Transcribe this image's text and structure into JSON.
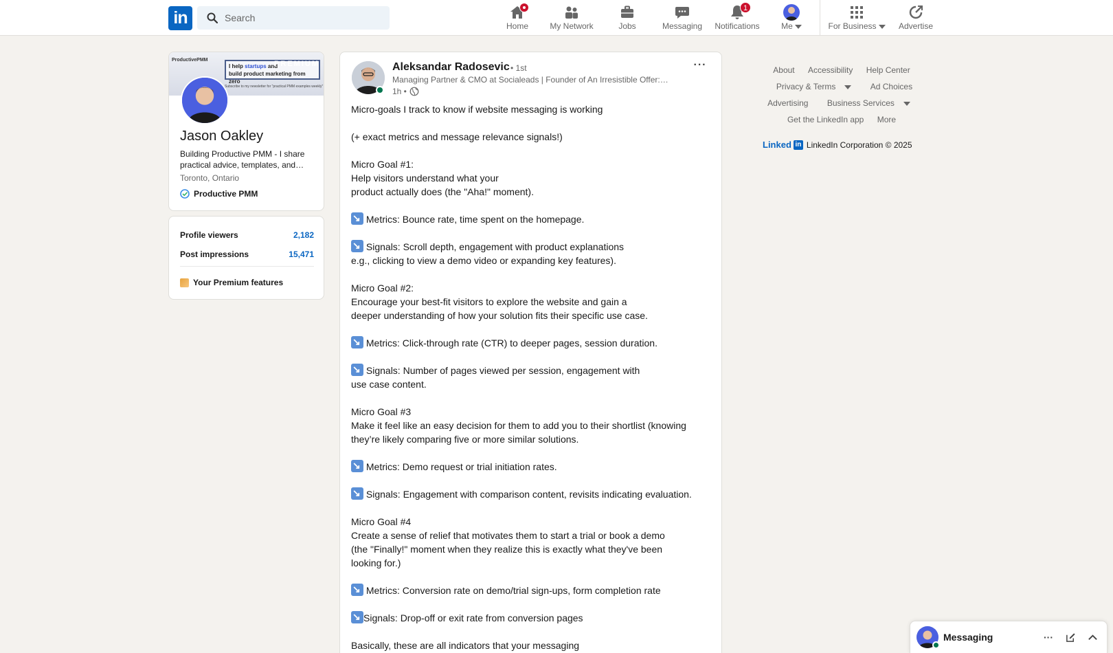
{
  "nav": {
    "logo_text": "in",
    "search_placeholder": "Search",
    "items": [
      {
        "label": "Home",
        "icon": "home-icon",
        "badge": "dot"
      },
      {
        "label": "My Network",
        "icon": "people-icon"
      },
      {
        "label": "Jobs",
        "icon": "briefcase-icon"
      },
      {
        "label": "Messaging",
        "icon": "chat-icon"
      },
      {
        "label": "Notifications",
        "icon": "bell-icon",
        "badge": "1"
      },
      {
        "label": "Me",
        "icon": "avatar"
      }
    ],
    "for_business": "For Business",
    "advertise": "Advertise"
  },
  "profile": {
    "banner_brand": "ProductivePMM",
    "banner_line1_pre": "I help ",
    "banner_line1_hl": "startups",
    "banner_line1_post": " and",
    "banner_line2": "build product marketing from zero",
    "banner_premium": "PREMIUM",
    "banner_sub": "Subscribe to my newsletter for \"practical PMM examples weekly\"",
    "name": "Jason Oakley",
    "headline": "Building Productive PMM - I share practical advice, templates, and…",
    "location": "Toronto, Ontario",
    "company": "Productive PMM"
  },
  "stats": {
    "profile_viewers_label": "Profile viewers",
    "profile_viewers_value": "2,182",
    "post_impressions_label": "Post impressions",
    "post_impressions_value": "15,471",
    "premium_features": "Your Premium features"
  },
  "post": {
    "author": "Aleksandar Radosevic",
    "degree": "• 1st",
    "subtitle": "Managing Partner & CMO at Socialeads | Founder of An Irresistible Offer:…",
    "time": "1h •",
    "menu": "···",
    "lines": [
      {
        "text": "Micro-goals I track to know if website messaging is working"
      },
      {
        "text": ""
      },
      {
        "text": "(+ exact metrics and message relevance signals!)"
      },
      {
        "text": ""
      },
      {
        "text": "Micro Goal #1:"
      },
      {
        "text": "Help visitors understand what your"
      },
      {
        "text": "product actually does (the \"Aha!\" moment)."
      },
      {
        "text": ""
      },
      {
        "text": " Metrics: Bounce rate, time spent on the homepage.",
        "arrow": true
      },
      {
        "text": ""
      },
      {
        "text": " Signals: Scroll depth, engagement with product explanations",
        "arrow": true
      },
      {
        "text": " e.g., clicking to view a demo video or expanding key features)."
      },
      {
        "text": ""
      },
      {
        "text": "Micro Goal #2:"
      },
      {
        "text": "Encourage your best-fit visitors to explore the website and gain a"
      },
      {
        "text": "deeper understanding of how your solution fits their specific use case."
      },
      {
        "text": ""
      },
      {
        "text": " Metrics: Click-through rate (CTR) to deeper pages, session duration.",
        "arrow": true
      },
      {
        "text": ""
      },
      {
        "text": " Signals: Number of pages viewed per session, engagement with",
        "arrow": true
      },
      {
        "text": "use case content."
      },
      {
        "text": ""
      },
      {
        "text": "Micro Goal #3"
      },
      {
        "text": "Make it feel like an easy decision for them to add you to their shortlist (knowing"
      },
      {
        "text": "they’re likely comparing five or more similar solutions."
      },
      {
        "text": ""
      },
      {
        "text": " Metrics: Demo request or trial initiation rates.",
        "arrow": true
      },
      {
        "text": ""
      },
      {
        "text": " Signals: Engagement with comparison content, revisits indicating evaluation.",
        "arrow": true
      },
      {
        "text": ""
      },
      {
        "text": "Micro Goal #4"
      },
      {
        "text": "Create a sense of relief that motivates them to start a trial or book a demo"
      },
      {
        "text": "(the \"Finally!\" moment when they realize this is exactly what they've been"
      },
      {
        "text": "looking for.)"
      },
      {
        "text": ""
      },
      {
        "text": " Metrics: Conversion rate on demo/trial sign-ups, form completion rate",
        "arrow": true
      },
      {
        "text": ""
      },
      {
        "text": "Signals: Drop-off or exit rate from conversion pages",
        "arrow": true
      },
      {
        "text": ""
      },
      {
        "text": "Basically, these are all indicators that your messaging"
      }
    ]
  },
  "footer": {
    "row1": [
      "About",
      "Accessibility",
      "Help Center"
    ],
    "row2": [
      "Privacy & Terms",
      "Ad Choices"
    ],
    "row3": [
      "Advertising",
      "Business Services"
    ],
    "row4": [
      "Get the LinkedIn app",
      "More"
    ],
    "brand_word": "Linked",
    "brand_in": "in",
    "copyright": "LinkedIn Corporation © 2025"
  },
  "messaging": {
    "label": "Messaging",
    "more": "···"
  },
  "colors": {
    "brand": "#0a66c2",
    "background": "#f4f2ee",
    "badge": "#cb112d",
    "online": "#01754f"
  }
}
